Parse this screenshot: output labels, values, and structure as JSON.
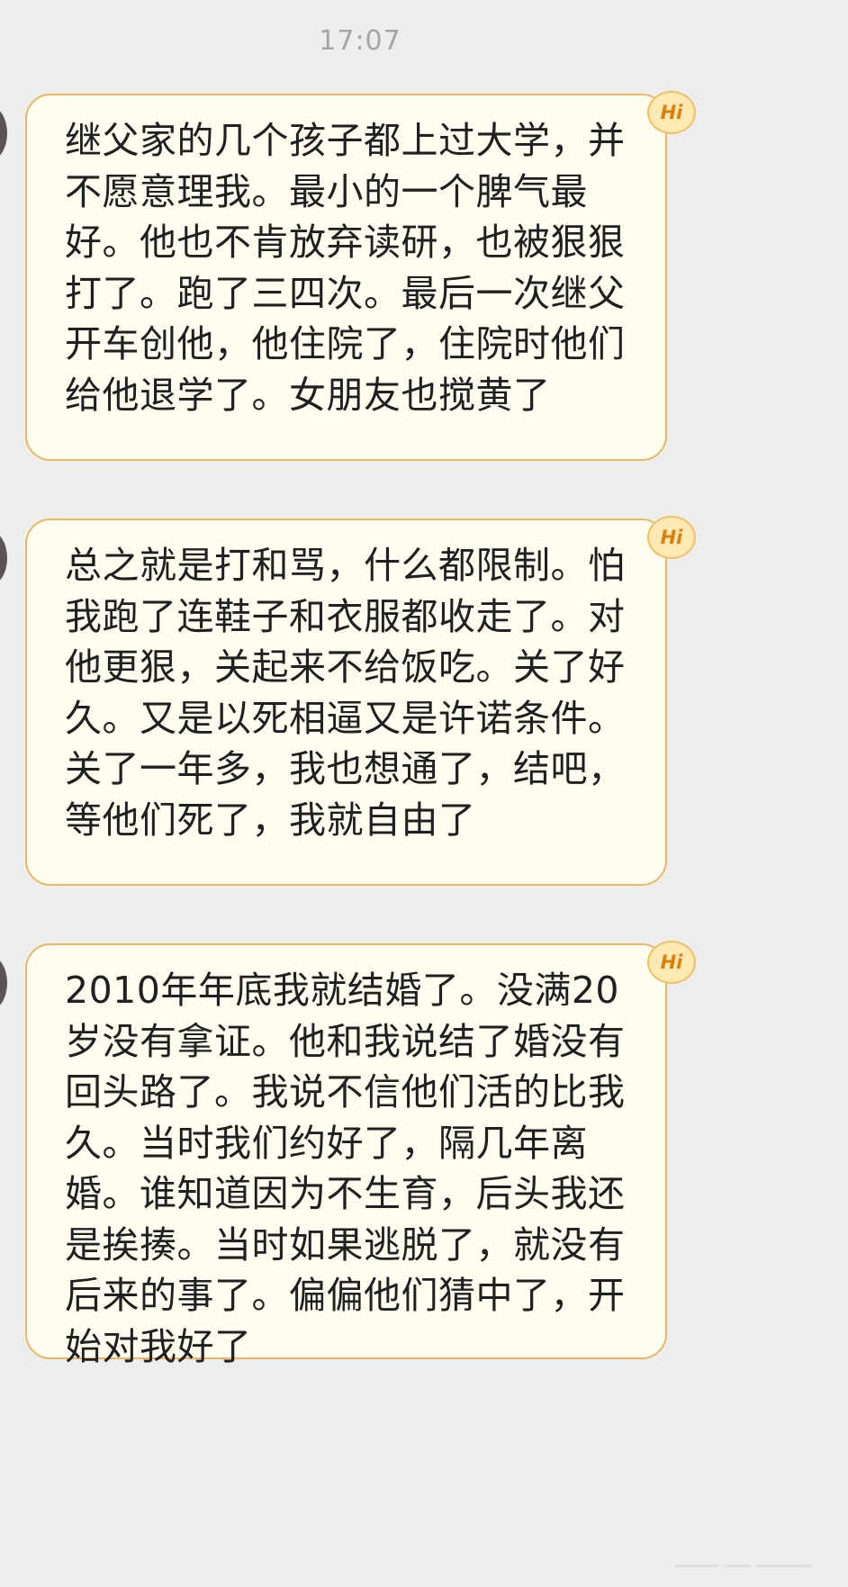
{
  "chat": {
    "timestamp": "17:07",
    "badge_label": "Hi",
    "messages": [
      {
        "text": "继父家的几个孩子都上过大学，并不愿意理我。最小的一个脾气最好。他也不肯放弃读研，也被狠狠打了。跑了三四次。最后一次继父开车创他，他住院了，住院时他们给他退学了。女朋友也搅黄了"
      },
      {
        "text": "总之就是打和骂，什么都限制。怕我跑了连鞋子和衣服都收走了。对他更狠，关起来不给饭吃。关了好久。又是以死相逼又是许诺条件。关了一年多，我也想通了，结吧，等他们死了，我就自由了"
      },
      {
        "text": "2010年年底我就结婚了。没满20岁没有拿证。他和我说结了婚没有回头路了。我说不信他们活的比我久。当时我们约好了，隔几年离婚。谁知道因为不生育，后头我还是挨揍。当时如果逃脱了，就没有后来的事了。偏偏他们猜中了，开始对我好了"
      }
    ]
  }
}
